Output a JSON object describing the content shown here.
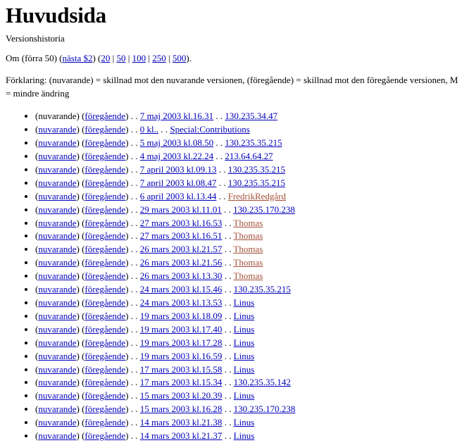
{
  "page": {
    "title": "Huvudsida",
    "subtitle": "Versionshistoria"
  },
  "pager": {
    "prefix": "Om (förra 50) (",
    "next_label": "nästa $2",
    "mid": ") (",
    "counts": [
      "20",
      "50",
      "100",
      "250",
      "500"
    ],
    "separator": " | ",
    "suffix": ").",
    "divider": "|"
  },
  "legend": {
    "text": "Förklaring: (nuvarande) = skillnad mot den nuvarande versionen, (föregående) = skillnad mot den föregående versionen, M = mindre ändring"
  },
  "labels": {
    "current": "nuvarande",
    "previous": "föregående",
    "open_paren": "(",
    "close_paren": ")",
    "dot_sep": " . . "
  },
  "colors": {
    "link": "#0000BB",
    "link_new": "#A5503A",
    "text": "#000000",
    "background": "#FFFFFF"
  },
  "history": [
    {
      "current_label": "nuvarande",
      "current_is_link": false,
      "previous_label": "föregående",
      "date": "7 maj 2003 kl.16.31",
      "user": "130.235.34.47",
      "user_is_new": false
    },
    {
      "current_label": "nuvarande",
      "current_is_link": true,
      "previous_label": "föregående",
      "date": "0 kl..",
      "user": "Special:Contributions",
      "user_is_new": false
    },
    {
      "current_label": "nuvarande",
      "current_is_link": true,
      "previous_label": "föregående",
      "date": "5 maj 2003 kl.08.50",
      "user": "130.235.35.215",
      "user_is_new": false
    },
    {
      "current_label": "nuvarande",
      "current_is_link": true,
      "previous_label": "föregående",
      "date": "4 maj 2003 kl.22.24",
      "user": "213.64.64.27",
      "user_is_new": false
    },
    {
      "current_label": "nuvarande",
      "current_is_link": true,
      "previous_label": "föregående",
      "date": "7 april 2003 kl.09.13",
      "user": "130.235.35.215",
      "user_is_new": false
    },
    {
      "current_label": "nuvarande",
      "current_is_link": true,
      "previous_label": "föregående",
      "date": "7 april 2003 kl.08.47",
      "user": "130.235.35.215",
      "user_is_new": false
    },
    {
      "current_label": "nuvarande",
      "current_is_link": true,
      "previous_label": "föregående",
      "date": "6 april 2003 kl.13.44",
      "user": "FredrikRedgård",
      "user_is_new": true
    },
    {
      "current_label": "nuvarande",
      "current_is_link": true,
      "previous_label": "föregående",
      "date": "29 mars 2003 kl.11.01",
      "user": "130.235.170.238",
      "user_is_new": false
    },
    {
      "current_label": "nuvarande",
      "current_is_link": true,
      "previous_label": "föregående",
      "date": "27 mars 2003 kl.16.53",
      "user": "Thomas",
      "user_is_new": true
    },
    {
      "current_label": "nuvarande",
      "current_is_link": true,
      "previous_label": "föregående",
      "date": "27 mars 2003 kl.16.51",
      "user": "Thomas",
      "user_is_new": true
    },
    {
      "current_label": "nuvarande",
      "current_is_link": true,
      "previous_label": "föregående",
      "date": "26 mars 2003 kl.21.57",
      "user": "Thomas",
      "user_is_new": true
    },
    {
      "current_label": "nuvarande",
      "current_is_link": true,
      "previous_label": "föregående",
      "date": "26 mars 2003 kl.21.56",
      "user": "Thomas",
      "user_is_new": true
    },
    {
      "current_label": "nuvarande",
      "current_is_link": true,
      "previous_label": "föregående",
      "date": "26 mars 2003 kl.13.30",
      "user": "Thomas",
      "user_is_new": true
    },
    {
      "current_label": "nuvarande",
      "current_is_link": true,
      "previous_label": "föregående",
      "date": "24 mars 2003 kl.15.46",
      "user": "130.235.35.215",
      "user_is_new": false
    },
    {
      "current_label": "nuvarande",
      "current_is_link": true,
      "previous_label": "föregående",
      "date": "24 mars 2003 kl.13.53",
      "user": "Linus",
      "user_is_new": false
    },
    {
      "current_label": "nuvarande",
      "current_is_link": true,
      "previous_label": "föregående",
      "date": "19 mars 2003 kl.18.09",
      "user": "Linus",
      "user_is_new": false
    },
    {
      "current_label": "nuvarande",
      "current_is_link": true,
      "previous_label": "föregående",
      "date": "19 mars 2003 kl.17.40",
      "user": "Linus",
      "user_is_new": false
    },
    {
      "current_label": "nuvarande",
      "current_is_link": true,
      "previous_label": "föregående",
      "date": "19 mars 2003 kl.17.28",
      "user": "Linus",
      "user_is_new": false
    },
    {
      "current_label": "nuvarande",
      "current_is_link": true,
      "previous_label": "föregående",
      "date": "19 mars 2003 kl.16.59",
      "user": "Linus",
      "user_is_new": false
    },
    {
      "current_label": "nuvarande",
      "current_is_link": true,
      "previous_label": "föregående",
      "date": "17 mars 2003 kl.15.58",
      "user": "Linus",
      "user_is_new": false
    },
    {
      "current_label": "nuvarande",
      "current_is_link": true,
      "previous_label": "föregående",
      "date": "17 mars 2003 kl.15.34",
      "user": "130.235.35.142",
      "user_is_new": false
    },
    {
      "current_label": "nuvarande",
      "current_is_link": true,
      "previous_label": "föregående",
      "date": "15 mars 2003 kl.20.39",
      "user": "Linus",
      "user_is_new": false
    },
    {
      "current_label": "nuvarande",
      "current_is_link": true,
      "previous_label": "föregående",
      "date": "15 mars 2003 kl.16.28",
      "user": "130.235.170.238",
      "user_is_new": false
    },
    {
      "current_label": "nuvarande",
      "current_is_link": true,
      "previous_label": "föregående",
      "date": "14 mars 2003 kl.21.38",
      "user": "Linus",
      "user_is_new": false
    },
    {
      "current_label": "nuvarande",
      "current_is_link": true,
      "previous_label": "föregående",
      "date": "14 mars 2003 kl.21.37",
      "user": "Linus",
      "user_is_new": false
    }
  ]
}
